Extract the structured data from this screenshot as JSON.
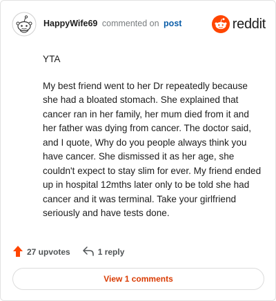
{
  "header": {
    "username": "HappyWife69",
    "action_text": "commented on",
    "post_link": "post",
    "brand": "reddit",
    "avatar_icon": "snoo-avatar-icon",
    "logo_icon": "reddit-logo-icon"
  },
  "comment": {
    "lead": "YTA",
    "body": "My best friend went to her Dr repeatedly because she had a bloated stomach. She explained that cancer ran in her family, her mum died from it and her father was dying from cancer. The doctor said, and I quote, Why do you people always think you have cancer. She dismissed it as her age, she couldn't expect to stay slim for ever. My friend ended up in hospital 12mths later only to be told she had cancer and it was terminal. Take your girlfriend seriously and have tests done."
  },
  "actions": {
    "upvotes": "27 upvotes",
    "replies": "1 reply",
    "upvote_icon": "upvote-arrow-icon",
    "reply_icon": "reply-arrow-icon"
  },
  "view_comments_label": "View 1 comments",
  "colors": {
    "accent": "#ff4500",
    "link": "#0a5da8",
    "view_button_text": "#d93a00"
  }
}
